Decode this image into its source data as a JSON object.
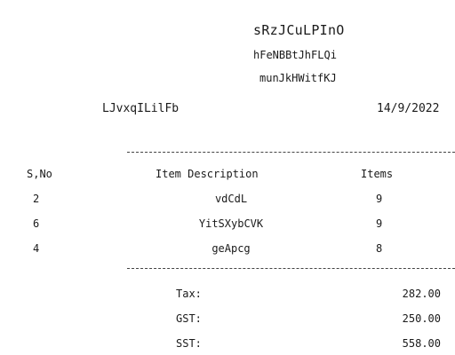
{
  "header": {
    "store_name": "sRzJCuLPInO",
    "line1": "hFeNBBtJhFLQi",
    "line2": "munJkHWitfKJ",
    "cashier": "LJvxqILilFb",
    "date": "14/9/2022"
  },
  "table": {
    "headers": {
      "sno": "S,No",
      "desc": "Item Description",
      "items": "Items"
    },
    "rows": [
      {
        "sno": "2",
        "desc": "vdCdL",
        "qty": "9"
      },
      {
        "sno": "6",
        "desc": "YitSXybCVK",
        "qty": "9"
      },
      {
        "sno": "4",
        "desc": "geApcg",
        "qty": "8"
      }
    ]
  },
  "totals": [
    {
      "label": "Tax:",
      "value": "282.00"
    },
    {
      "label": "GST:",
      "value": "250.00"
    },
    {
      "label": "SST:",
      "value": "558.00"
    }
  ]
}
